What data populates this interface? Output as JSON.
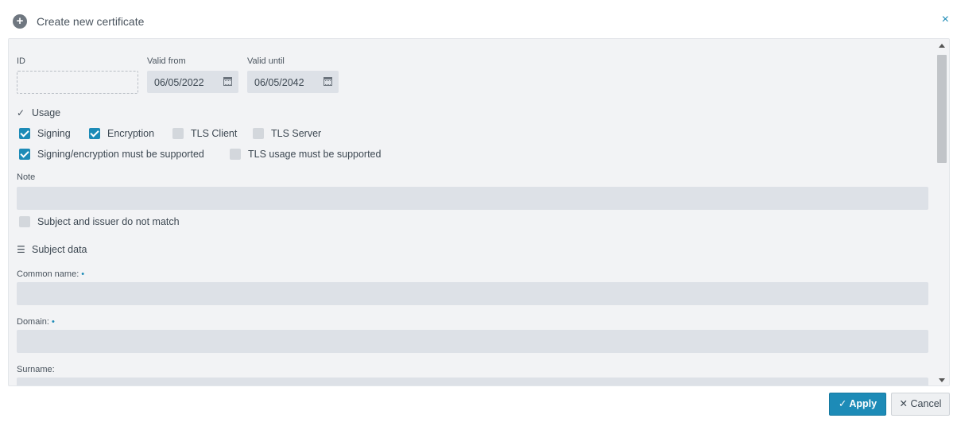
{
  "header": {
    "title": "Create new certificate",
    "plus_icon": "+",
    "close_icon": "×"
  },
  "fields": {
    "id": {
      "label": "ID",
      "value": ""
    },
    "valid_from": {
      "label": "Valid from",
      "value": "06/05/2022"
    },
    "valid_until": {
      "label": "Valid until",
      "value": "06/05/2042"
    }
  },
  "usage": {
    "title": "Usage",
    "checkboxes": [
      {
        "label": "Signing",
        "checked": true
      },
      {
        "label": "Encryption",
        "checked": true
      },
      {
        "label": "TLS Client",
        "checked": false
      },
      {
        "label": "TLS Server",
        "checked": false
      },
      {
        "label": "Signing/encryption must be supported",
        "checked": true
      },
      {
        "label": "TLS usage must be supported",
        "checked": false
      }
    ]
  },
  "note": {
    "label": "Note",
    "value": ""
  },
  "subject_mismatch": {
    "label": "Subject and issuer do not match",
    "checked": false
  },
  "subject": {
    "title": "Subject data",
    "common_name": {
      "label": "Common name:",
      "required": "•",
      "value": ""
    },
    "domain": {
      "label": "Domain:",
      "required": "•",
      "value": ""
    },
    "surname": {
      "label": "Surname:",
      "value": ""
    }
  },
  "footer": {
    "apply_label": "Apply",
    "cancel_label": "Cancel"
  },
  "colors": {
    "accent": "#1d8bb7",
    "field_bg": "#dde1e7",
    "panel_bg": "#f2f3f5"
  }
}
